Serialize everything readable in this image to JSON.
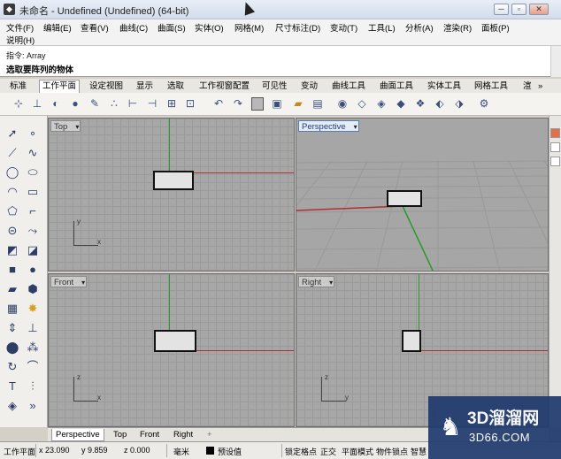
{
  "window": {
    "title": "未命名 - Undefined (Undefined) (64-bit)",
    "logo": "rhino-logo-icon",
    "controls": [
      "minimize-icon",
      "restore-icon",
      "close-icon"
    ]
  },
  "menu": {
    "row1": [
      "文件(F)",
      "编辑(E)",
      "查看(V)",
      "曲线(C)",
      "曲面(S)",
      "实体(O)",
      "网格(M)",
      "尺寸标注(D)",
      "变动(T)",
      "工具(L)",
      "分析(A)",
      "渲染(R)",
      "面板(P)"
    ],
    "row2": [
      "说明(H)"
    ]
  },
  "command": {
    "history": "指令: Array",
    "prompt": "选取要阵列的物体"
  },
  "tabs": [
    "标准",
    "工作平面",
    "设定视图",
    "显示",
    "选取",
    "工作视窗配置",
    "可见性",
    "变动",
    "曲线工具",
    "曲面工具",
    "实体工具",
    "网格工具",
    "渲"
  ],
  "tabs_active": "工作平面",
  "tabs_overflow": "»",
  "viewports": {
    "top": {
      "label": "Top",
      "axis_x": "x",
      "axis_y": "y"
    },
    "perspective": {
      "label": "Perspective"
    },
    "front": {
      "label": "Front",
      "axis_x": "x",
      "axis_z": "z"
    },
    "right": {
      "label": "Right",
      "axis_y": "y",
      "axis_z": "z"
    }
  },
  "viewport_tabs": [
    "Perspective",
    "Top",
    "Front",
    "Right"
  ],
  "viewport_tabs_active": "Perspective",
  "viewport_tab_add": "+",
  "status": {
    "plane": "工作平面",
    "x": "x 23.090",
    "y": "y 9.859",
    "z": "z 0.000",
    "unit": "毫米",
    "layer": "预设值",
    "snap": "锁定格点",
    "ortho": "正交",
    "planar": "平面模式",
    "osnap": "物件锁点",
    "smart": "智慧"
  },
  "watermark": {
    "name": "3D溜溜网",
    "url": "3D66.COM"
  },
  "colors": {
    "x_axis": "#b03030",
    "y_axis": "#2a9a2a",
    "viewport_bg": "#a7a7a7",
    "active_viewport": "#5a7bb5"
  }
}
